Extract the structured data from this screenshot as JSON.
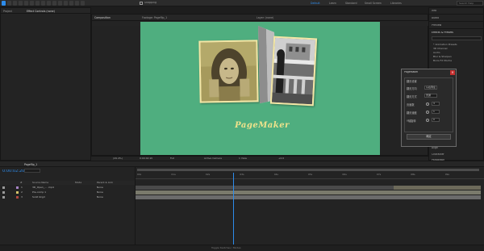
{
  "toolbar": {
    "snapping_label": "Snapping",
    "workspaces": [
      "Default",
      "Learn",
      "Standard",
      "Small Screen",
      "Libraries"
    ],
    "search_placeholder": "Search Help"
  },
  "project_panel": {
    "tab_label": "Project",
    "effect_controls_tab": "Effect Controls (none)"
  },
  "composition_panel": {
    "tab_label": "Composition",
    "comp_name": "Pageflip_1",
    "footage_tab": "Footage: Pageflip_1",
    "layer_tab": "Layer: (none)",
    "breadcrumb": [
      "Pageflip_1",
      "image_1"
    ]
  },
  "canvas": {
    "script_title": "PageMaker"
  },
  "viewer_footer": {
    "zoom": "(49.4%)",
    "timecode": "0:00:02:20",
    "resolution": "Full",
    "camera": "Active Camera",
    "views": "1 View",
    "exposure": "+0.0"
  },
  "right_panel": {
    "info_tab": "Info",
    "audio_tab": "Audio",
    "preview_tab": "Preview",
    "effects_tab": "Effects & Presets",
    "effects_items": [
      "* Animation Presets",
      "3D Channel",
      "Audio",
      "Blur & Sharpen",
      "Boris FX Mocha"
    ],
    "align_tab": "Align",
    "character_tab": "Character",
    "paragraph_tab": "Paragraph"
  },
  "dialog": {
    "title": "PageMaker",
    "section_label": "翻页设置",
    "fields": [
      {
        "label": "翻页方向",
        "value": "从右到左"
      },
      {
        "label": "翻页方式",
        "value": "普通"
      },
      {
        "label": "页面数",
        "value": "3"
      },
      {
        "label": "翻页速度",
        "value": "1"
      },
      {
        "label": "Y轴旋转",
        "value": "0"
      }
    ],
    "ok_label": "确定"
  },
  "timeline": {
    "tab_label": "Pageflip_1",
    "timecode": "0:00:02:20",
    "column_headers": [
      "#",
      "Source Name",
      "Mode",
      "Parent & Link"
    ],
    "layers": [
      {
        "num": "1",
        "name": "3D_Open_... .mp4",
        "mode": "None"
      },
      {
        "num": "2",
        "name": "Pre-comp 1",
        "mode": "None"
      },
      {
        "num": "3",
        "name": "Solid bkgd",
        "mode": "None"
      }
    ],
    "ruler_ticks": [
      "00s",
      "01s",
      "02s",
      "03s",
      "04s",
      "05s",
      "06s",
      "07s",
      "08s",
      "09s"
    ],
    "playhead_seconds": 2.8
  },
  "status_bar": {
    "text": "Toggle Switches / Modes"
  }
}
